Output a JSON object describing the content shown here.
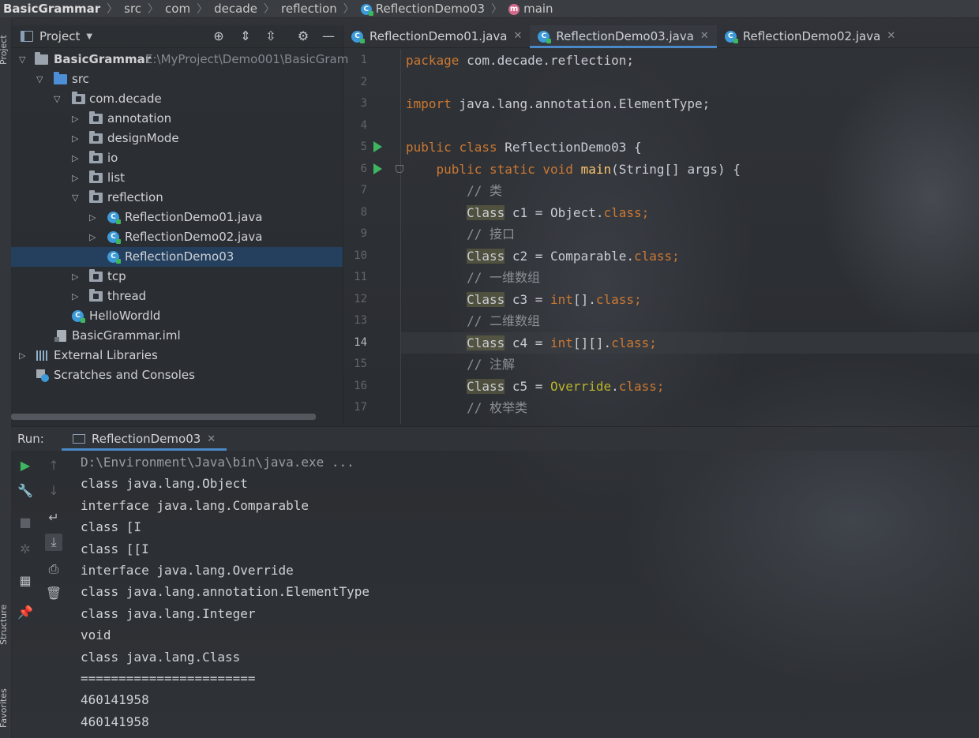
{
  "breadcrumb": {
    "items": [
      "BasicGrammar",
      "src",
      "com",
      "decade",
      "reflection",
      "ReflectionDemo03",
      "main"
    ],
    "class_icon": "class-c",
    "method_icon": "method-m"
  },
  "left_strip": {
    "project_label": "Project",
    "structure_label": "Structure",
    "favorites_label": "Favorites"
  },
  "project_panel": {
    "title": "Project",
    "tree": [
      {
        "label": "BasicGrammar",
        "path": "E:\\MyProject\\Demo001\\BasicGram",
        "icon": "folder",
        "expanded": true
      },
      {
        "label": "src",
        "icon": "folder-blue",
        "expanded": true
      },
      {
        "label": "com.decade",
        "icon": "package",
        "expanded": true
      },
      {
        "label": "annotation",
        "icon": "package",
        "expanded": false
      },
      {
        "label": "designMode",
        "icon": "package",
        "expanded": false
      },
      {
        "label": "io",
        "icon": "package",
        "expanded": false
      },
      {
        "label": "list",
        "icon": "package",
        "expanded": false
      },
      {
        "label": "reflection",
        "icon": "package",
        "expanded": true
      },
      {
        "label": "ReflectionDemo01.java",
        "icon": "java-class",
        "expanded": false
      },
      {
        "label": "ReflectionDemo02.java",
        "icon": "java-class",
        "expanded": false
      },
      {
        "label": "ReflectionDemo03",
        "icon": "java-class",
        "selected": true
      },
      {
        "label": "tcp",
        "icon": "package",
        "expanded": false
      },
      {
        "label": "thread",
        "icon": "package",
        "expanded": false
      },
      {
        "label": "HelloWordld",
        "icon": "java-class"
      },
      {
        "label": "BasicGrammar.iml",
        "icon": "iml-file"
      },
      {
        "label": "External Libraries",
        "icon": "library",
        "expanded": false
      },
      {
        "label": "Scratches and Consoles",
        "icon": "scratch"
      }
    ]
  },
  "editor": {
    "tabs": [
      {
        "label": "ReflectionDemo01.java",
        "active": false
      },
      {
        "label": "ReflectionDemo03.java",
        "active": true
      },
      {
        "label": "ReflectionDemo02.java",
        "active": false
      }
    ],
    "current_line": 14,
    "lines": [
      {
        "n": "1",
        "tokens": [
          {
            "t": "package",
            "c": "kw"
          },
          {
            "t": " com.decade.reflection;",
            "c": ""
          }
        ]
      },
      {
        "n": "2",
        "tokens": []
      },
      {
        "n": "3",
        "tokens": [
          {
            "t": "import",
            "c": "kw"
          },
          {
            "t": " java.lang.annotation.ElementType;",
            "c": ""
          }
        ]
      },
      {
        "n": "4",
        "tokens": []
      },
      {
        "n": "5",
        "tokens": [
          {
            "t": "public",
            "c": "kw"
          },
          {
            "t": " ",
            "c": ""
          },
          {
            "t": "class",
            "c": "kw"
          },
          {
            "t": " ReflectionDemo03 {",
            "c": ""
          }
        ]
      },
      {
        "n": "6",
        "tokens": [
          {
            "t": "    ",
            "c": ""
          },
          {
            "t": "public",
            "c": "kw"
          },
          {
            "t": " ",
            "c": ""
          },
          {
            "t": "static",
            "c": "kw"
          },
          {
            "t": " ",
            "c": ""
          },
          {
            "t": "void",
            "c": "kw"
          },
          {
            "t": " ",
            "c": ""
          },
          {
            "t": "main",
            "c": "meth"
          },
          {
            "t": "(String[] args) {",
            "c": ""
          }
        ]
      },
      {
        "n": "7",
        "tokens": [
          {
            "t": "        ",
            "c": ""
          },
          {
            "t": "// 类",
            "c": "cmt"
          }
        ]
      },
      {
        "n": "8",
        "tokens": [
          {
            "t": "        ",
            "c": ""
          },
          {
            "t": "Class",
            "c": "cls-hl"
          },
          {
            "t": " c1 = Object.",
            "c": ""
          },
          {
            "t": "class",
            "c": "kw"
          },
          {
            "t": ";",
            "c": "kw"
          }
        ]
      },
      {
        "n": "9",
        "tokens": [
          {
            "t": "        ",
            "c": ""
          },
          {
            "t": "// 接口",
            "c": "cmt"
          }
        ]
      },
      {
        "n": "10",
        "tokens": [
          {
            "t": "        ",
            "c": ""
          },
          {
            "t": "Class",
            "c": "cls-hl"
          },
          {
            "t": " c2 = Comparable.",
            "c": ""
          },
          {
            "t": "class",
            "c": "kw"
          },
          {
            "t": ";",
            "c": "kw"
          }
        ]
      },
      {
        "n": "11",
        "tokens": [
          {
            "t": "        ",
            "c": ""
          },
          {
            "t": "// 一维数组",
            "c": "cmt"
          }
        ]
      },
      {
        "n": "12",
        "tokens": [
          {
            "t": "        ",
            "c": ""
          },
          {
            "t": "Class",
            "c": "cls-hl"
          },
          {
            "t": " c3 = ",
            "c": ""
          },
          {
            "t": "int",
            "c": "kw"
          },
          {
            "t": "[].",
            "c": ""
          },
          {
            "t": "class",
            "c": "kw"
          },
          {
            "t": ";",
            "c": "kw"
          }
        ]
      },
      {
        "n": "13",
        "tokens": [
          {
            "t": "        ",
            "c": ""
          },
          {
            "t": "// 二维数组",
            "c": "cmt"
          }
        ]
      },
      {
        "n": "14",
        "tokens": [
          {
            "t": "        ",
            "c": ""
          },
          {
            "t": "Class",
            "c": "cls-hl"
          },
          {
            "t": " c4 = ",
            "c": ""
          },
          {
            "t": "int",
            "c": "kw"
          },
          {
            "t": "[][].",
            "c": ""
          },
          {
            "t": "class",
            "c": "kw"
          },
          {
            "t": ";",
            "c": "kw"
          }
        ]
      },
      {
        "n": "15",
        "tokens": [
          {
            "t": "        ",
            "c": ""
          },
          {
            "t": "// 注解",
            "c": "cmt"
          }
        ]
      },
      {
        "n": "16",
        "tokens": [
          {
            "t": "        ",
            "c": ""
          },
          {
            "t": "Class",
            "c": "cls-hl"
          },
          {
            "t": " c5 = ",
            "c": ""
          },
          {
            "t": "Override",
            "c": "annot"
          },
          {
            "t": ".",
            "c": ""
          },
          {
            "t": "class",
            "c": "kw"
          },
          {
            "t": ";",
            "c": "kw"
          }
        ]
      },
      {
        "n": "17",
        "tokens": [
          {
            "t": "        ",
            "c": ""
          },
          {
            "t": "// 枚举类",
            "c": "cmt"
          }
        ]
      }
    ],
    "run_marker_lines": [
      5,
      6
    ]
  },
  "run_panel": {
    "label": "Run:",
    "tab_label": "ReflectionDemo03",
    "output": [
      "D:\\Environment\\Java\\bin\\java.exe ...",
      "class java.lang.Object",
      "interface java.lang.Comparable",
      "class [I",
      "class [[I",
      "interface java.lang.Override",
      "class java.lang.annotation.ElementType",
      "class java.lang.Integer",
      "void",
      "class java.lang.Class",
      "=======================",
      "460141958",
      "460141958"
    ]
  },
  "colors": {
    "keyword": "#cc7832",
    "method": "#ffc66d",
    "comment": "#8c8f94",
    "selection": "#24405e",
    "run_green": "#3fb561",
    "accent_blue": "#4a88c7"
  }
}
